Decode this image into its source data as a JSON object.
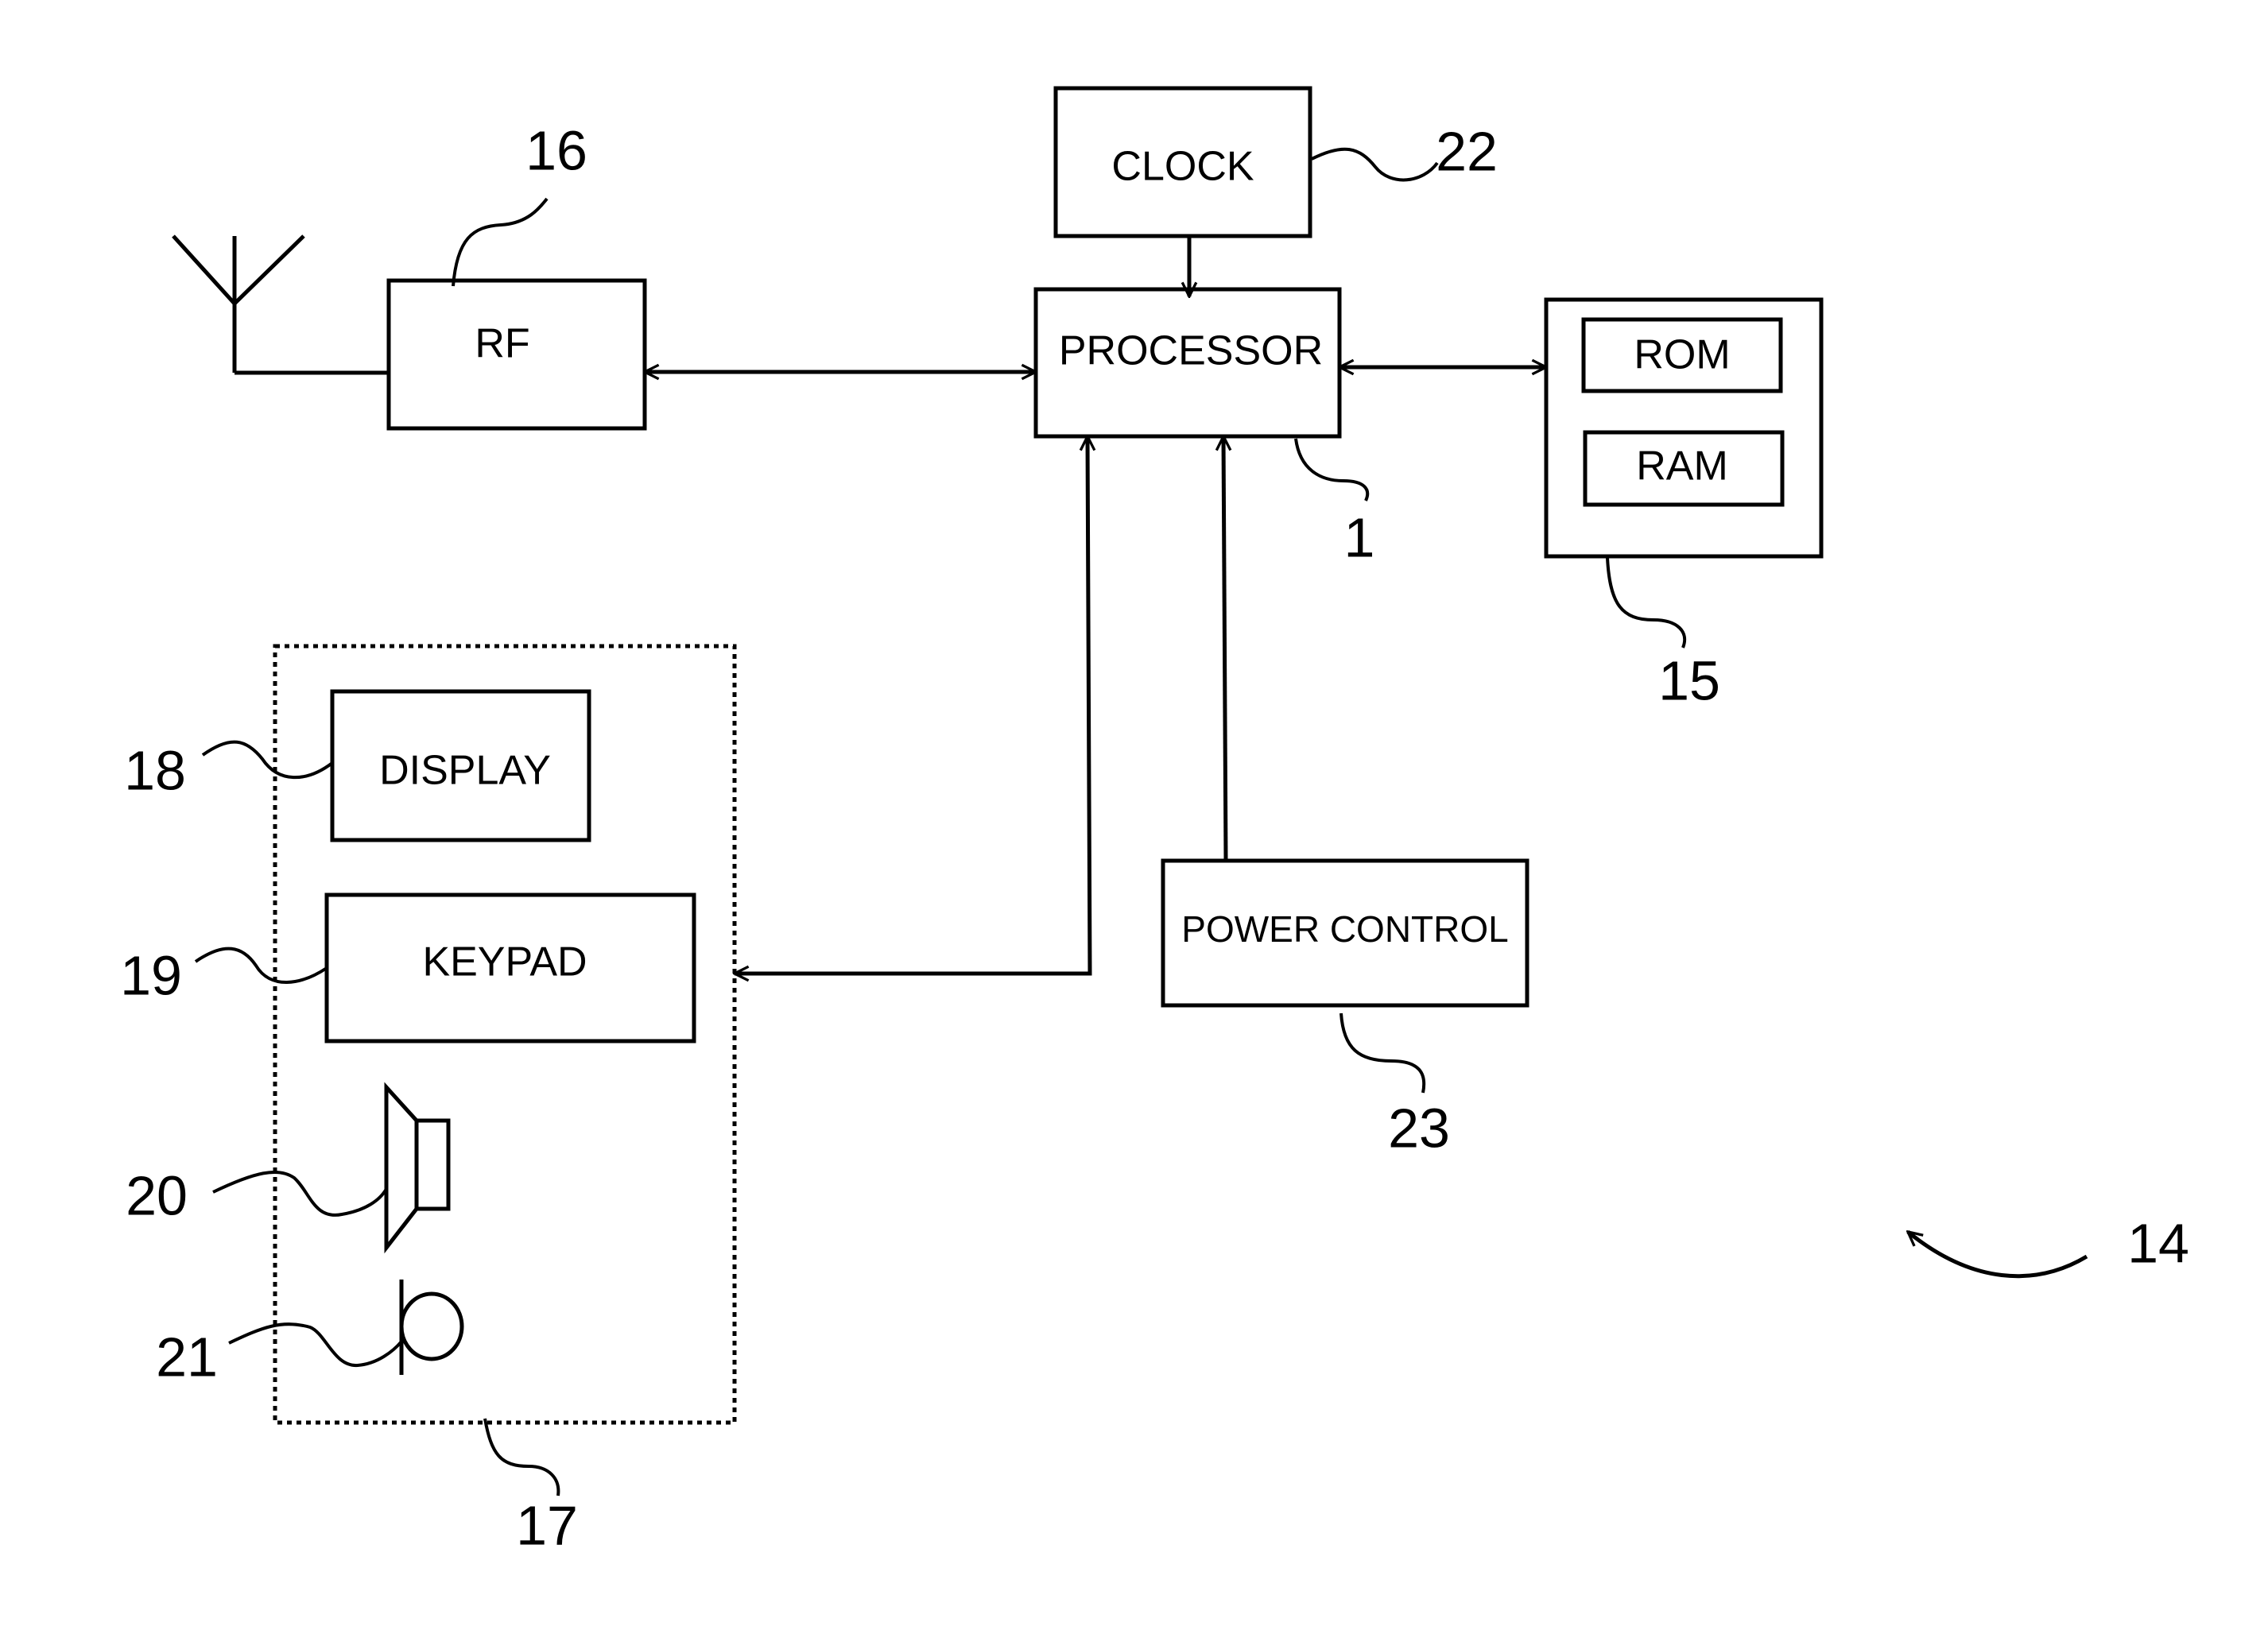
{
  "figure": {
    "reference_numeral": "14",
    "blocks": {
      "clock": {
        "label": "CLOCK",
        "ref": "22"
      },
      "processor": {
        "label": "PROCESSOR",
        "ref": "1"
      },
      "memory": {
        "ref": "15",
        "rom": "ROM",
        "ram": "RAM"
      },
      "rf": {
        "label": "RF",
        "ref": "16"
      },
      "power_control": {
        "label": "POWER CONTROL",
        "ref": "23"
      },
      "user_interface": {
        "ref": "17"
      },
      "display": {
        "label": "DISPLAY",
        "ref": "18"
      },
      "keypad": {
        "label": "KEYPAD",
        "ref": "19"
      },
      "speaker": {
        "ref": "20"
      },
      "microphone": {
        "ref": "21"
      }
    },
    "connections": [
      {
        "from": "clock",
        "to": "processor",
        "direction": "one-way"
      },
      {
        "from": "rf",
        "to": "processor",
        "direction": "bidirectional"
      },
      {
        "from": "processor",
        "to": "memory",
        "direction": "bidirectional"
      },
      {
        "from": "user_interface",
        "to": "processor",
        "direction": "bidirectional"
      },
      {
        "from": "power_control",
        "to": "processor",
        "direction": "one-way"
      },
      {
        "from": "antenna",
        "to": "rf",
        "direction": "none"
      }
    ]
  }
}
